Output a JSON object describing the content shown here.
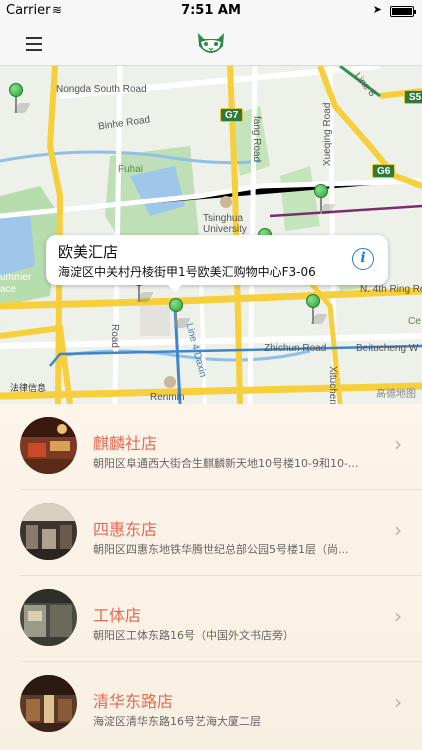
{
  "status_bar": {
    "carrier": "Carrier",
    "wifi_icon": "wifi-icon",
    "time": "7:51 AM",
    "location_icon": "location-arrow-icon",
    "battery_icon": "battery-icon"
  },
  "nav": {
    "menu_icon": "hamburger-menu-icon",
    "logo": "cat-logo"
  },
  "map": {
    "labels": {
      "nongda_south_road": "Nongda South Road",
      "binhe_road": "Binhe Road",
      "fuhai": "Fuhai",
      "tsinghua": "Tsinghua",
      "university": "University",
      "xueqing_road": "Xueqing Road",
      "zhichun_road": "Zhichun Road",
      "beitucheng": "Beitucheng W",
      "n4_ring": "N. 4th Ring Ro",
      "renmin": "Renmin",
      "line4": "Line 4:Daxin",
      "line8": "Line 8",
      "xitucheng": "Xitucheng",
      "fang_road": "fang Road",
      "shan_road": "Road",
      "summer": "ummer",
      "ace": "ace",
      "ce": "Ce"
    },
    "shields": {
      "g7": "G7",
      "g6": "G6",
      "s5": "S5"
    },
    "callout": {
      "title": "欧美汇店",
      "address": "海淀区中关村丹棱街甲1号欧美汇购物中心F3-06",
      "info_icon": "info-icon"
    },
    "legal": "法律信息",
    "provider": "高德地图"
  },
  "stores": [
    {
      "name": "麒麟社店",
      "address": "朝阳区阜通西大街合生麒麟新天地10号楼10-9和10-..."
    },
    {
      "name": "四惠东店",
      "address": "朝阳区四惠东地铁华腾世纪总部公园5号楼1层（尚..."
    },
    {
      "name": "工体店",
      "address": "朝阳区工体东路16号（中国外文书店旁）"
    },
    {
      "name": "清华东路店",
      "address": "海淀区清华东路16号艺海大厦二层"
    }
  ],
  "colors": {
    "accent": "#e26b52",
    "pin_green": "#27a33a",
    "info_blue": "#1e7bd9",
    "road_yellow": "#f6cf3a",
    "map_green": "#a8d5a0"
  }
}
